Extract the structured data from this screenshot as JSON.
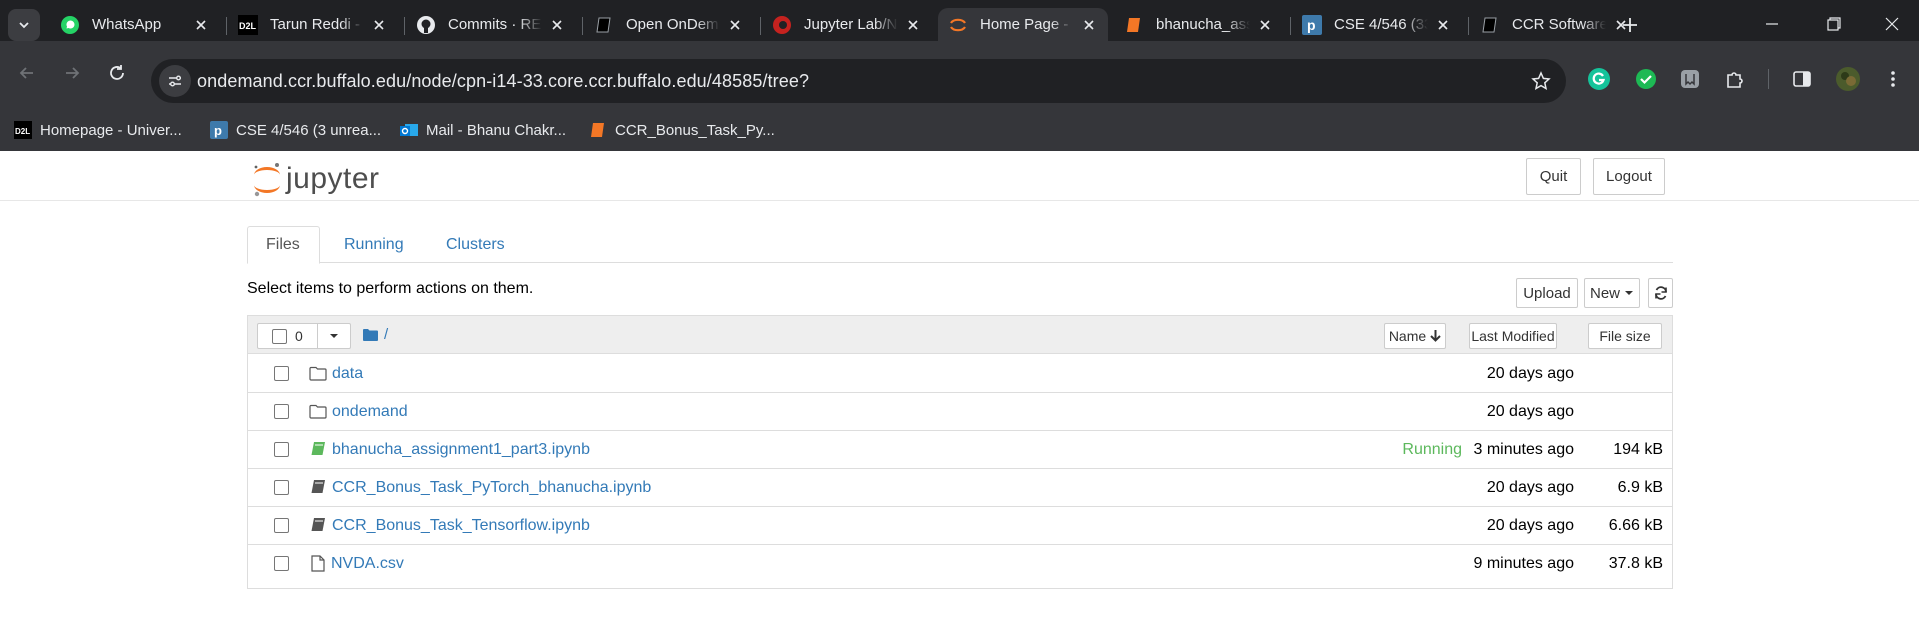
{
  "browser": {
    "tabs": [
      {
        "title": "WhatsApp",
        "icon": "whatsapp-icon"
      },
      {
        "title": "Tarun Reddi -",
        "icon": "d2l-icon"
      },
      {
        "title": "Commits · RE",
        "icon": "github-icon"
      },
      {
        "title": "Open OnDem",
        "icon": "book-icon"
      },
      {
        "title": "Jupyter Lab/N",
        "icon": "red-circle-icon"
      },
      {
        "title": "Home Page -",
        "icon": "jupyter-icon",
        "active": true
      },
      {
        "title": "bhanucha_ass",
        "icon": "orange-book-icon"
      },
      {
        "title": "CSE 4/546 (33",
        "icon": "piazza-icon"
      },
      {
        "title": "CCR Software",
        "icon": "book-icon"
      }
    ],
    "url": "ondemand.ccr.buffalo.edu/node/cpn-i14-33.core.ccr.buffalo.edu/48585/tree?",
    "bookmarks": [
      {
        "label": "Homepage - Univer...",
        "icon": "d2l-icon"
      },
      {
        "label": "CSE 4/546 (3 unrea...",
        "icon": "piazza-icon"
      },
      {
        "label": "Mail - Bhanu Chakr...",
        "icon": "outlook-icon"
      },
      {
        "label": "CCR_Bonus_Task_Py...",
        "icon": "orange-book-icon"
      }
    ]
  },
  "jupyter": {
    "logo_text": "jupyter",
    "quit_label": "Quit",
    "logout_label": "Logout",
    "tabs": [
      "Files",
      "Running",
      "Clusters"
    ],
    "select_text": "Select items to perform actions on them.",
    "upload_label": "Upload",
    "new_label": "New",
    "selected_count": "0",
    "breadcrumb": "/",
    "columns": {
      "name": "Name",
      "modified": "Last Modified",
      "size": "File size"
    },
    "files": [
      {
        "name": "data",
        "type": "folder",
        "status": "",
        "modified": "20 days ago",
        "size": ""
      },
      {
        "name": "ondemand",
        "type": "folder",
        "status": "",
        "modified": "20 days ago",
        "size": ""
      },
      {
        "name": "bhanucha_assignment1_part3.ipynb",
        "type": "notebook-running",
        "status": "Running",
        "modified": "3 minutes ago",
        "size": "194 kB"
      },
      {
        "name": "CCR_Bonus_Task_PyTorch_bhanucha.ipynb",
        "type": "notebook",
        "status": "",
        "modified": "20 days ago",
        "size": "6.9 kB"
      },
      {
        "name": "CCR_Bonus_Task_Tensorflow.ipynb",
        "type": "notebook",
        "status": "",
        "modified": "20 days ago",
        "size": "6.66 kB"
      },
      {
        "name": "NVDA.csv",
        "type": "file",
        "status": "",
        "modified": "9 minutes ago",
        "size": "37.8 kB"
      }
    ]
  },
  "colors": {
    "link": "#337ab7",
    "running": "#5cb85c",
    "chrome_dark": "#202124",
    "chrome_mid": "#35363a"
  }
}
